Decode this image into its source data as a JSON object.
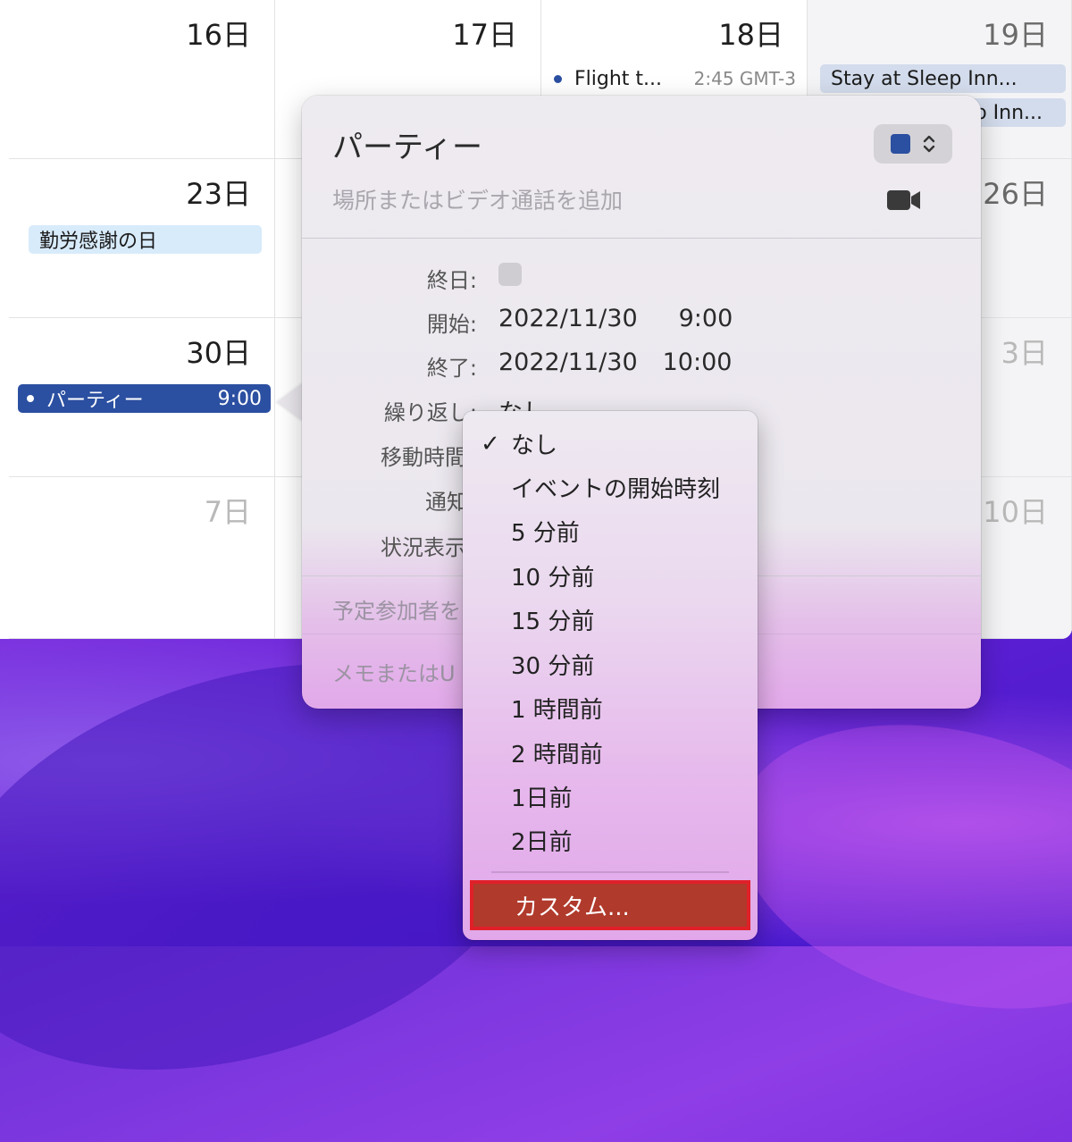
{
  "calendar": {
    "days": {
      "d16": "16日",
      "d17": "17日",
      "d18": "18日",
      "d19": "19日",
      "d23": "23日",
      "d26": "26日",
      "d30": "30日",
      "d3": "3日",
      "d7": "7日",
      "d10": "10日"
    },
    "events": {
      "flight_title": "Flight t...",
      "flight_time": "2:45 GMT-3",
      "stay1": "Stay at Sleep Inn...",
      "stay2": "p Inn...",
      "holiday": "勤労感謝の日",
      "party_title": "パーティー",
      "party_time": "9:00"
    }
  },
  "popover": {
    "title": "パーティー",
    "location_placeholder": "場所またはビデオ通話を追加",
    "color": "#2b4fa1",
    "fields": {
      "allday_label": "終日:",
      "start_label": "開始:",
      "start_date": "2022/11/30",
      "start_time": "9:00",
      "end_label": "終了:",
      "end_date": "2022/11/30",
      "end_time": "10:00",
      "repeat_label": "繰り返し:",
      "repeat_value": "なし",
      "travel_label": "移動時間",
      "alert_label": "通知",
      "status_label": "状況表示"
    },
    "invitees_placeholder": "予定参加者を",
    "notes_placeholder": "メモまたはU"
  },
  "menu": {
    "items": [
      {
        "label": "なし",
        "checked": true
      },
      {
        "label": "イベントの開始時刻"
      },
      {
        "label": "5 分前"
      },
      {
        "label": "10 分前"
      },
      {
        "label": "15 分前"
      },
      {
        "label": "30 分前"
      },
      {
        "label": "1 時間前"
      },
      {
        "label": "2 時間前"
      },
      {
        "label": "1日前"
      },
      {
        "label": "2日前"
      }
    ],
    "checkmark": "✓",
    "custom": "カスタム..."
  }
}
